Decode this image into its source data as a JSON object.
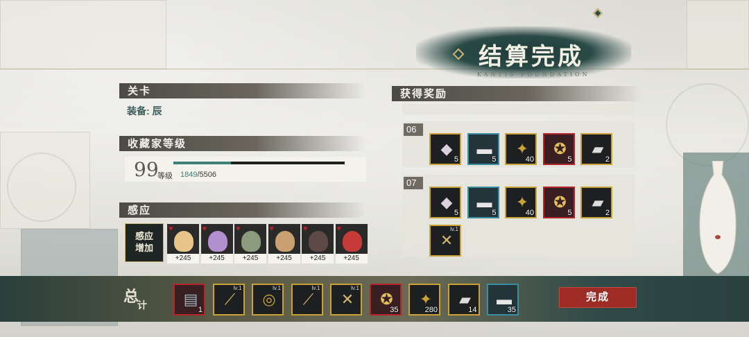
{
  "title": "结算完成",
  "title_sub": "KANTIS FOUNDATION",
  "stage": {
    "header": "关卡",
    "equipment_label": "装备: 辰"
  },
  "collector": {
    "header": "收藏家等级",
    "level": "99",
    "level_unit": "等级",
    "exp_current": "1849",
    "exp_max": "/5506",
    "exp_fraction": 0.336
  },
  "resonance": {
    "header": "感应",
    "tag_line1": "感应",
    "tag_line2": "增加",
    "characters": [
      {
        "bonus": "+245",
        "color": "#e8c48a"
      },
      {
        "bonus": "+245",
        "color": "#b48fd0"
      },
      {
        "bonus": "+245",
        "color": "#8a9b7e"
      },
      {
        "bonus": "+245",
        "color": "#c8a071"
      },
      {
        "bonus": "+245",
        "color": "#5e4a44"
      },
      {
        "bonus": "+245",
        "color": "#c63a3a"
      }
    ]
  },
  "rewards": {
    "header": "获得奖励",
    "blocks": [
      {
        "label": "06",
        "items": [
          {
            "icon": "ore-icon",
            "count": "5"
          },
          {
            "icon": "metal-block-icon",
            "count": "5"
          },
          {
            "icon": "banner-scroll-icon",
            "count": "40"
          },
          {
            "icon": "medal-icon",
            "count": "5"
          },
          {
            "icon": "anvil-icon",
            "count": "2"
          }
        ]
      },
      {
        "label": "07",
        "items": [
          {
            "icon": "ore-icon",
            "count": "5"
          },
          {
            "icon": "metal-block-icon",
            "count": "5"
          },
          {
            "icon": "banner-scroll-icon",
            "count": "40"
          },
          {
            "icon": "medal-icon",
            "count": "5"
          },
          {
            "icon": "anvil-icon",
            "count": "2"
          },
          {
            "icon": "crossbow-icon",
            "count": "",
            "level": "lv.1"
          }
        ]
      }
    ]
  },
  "total": {
    "label": "总",
    "label_small": "计",
    "items": [
      {
        "icon": "document-icon",
        "count": "1"
      },
      {
        "icon": "spear-icon",
        "count": "",
        "level": "lv.1"
      },
      {
        "icon": "ring-icon",
        "count": "",
        "level": "lv.1"
      },
      {
        "icon": "spear-icon",
        "count": "",
        "level": "lv.1"
      },
      {
        "icon": "crossbow-icon",
        "count": "",
        "level": "lv.1"
      },
      {
        "icon": "medal-icon",
        "count": "35"
      },
      {
        "icon": "banner-scroll-icon",
        "count": "280"
      },
      {
        "icon": "anvil-icon",
        "count": "14"
      },
      {
        "icon": "metal-block-icon",
        "count": "35"
      }
    ]
  },
  "done_button": "完成"
}
